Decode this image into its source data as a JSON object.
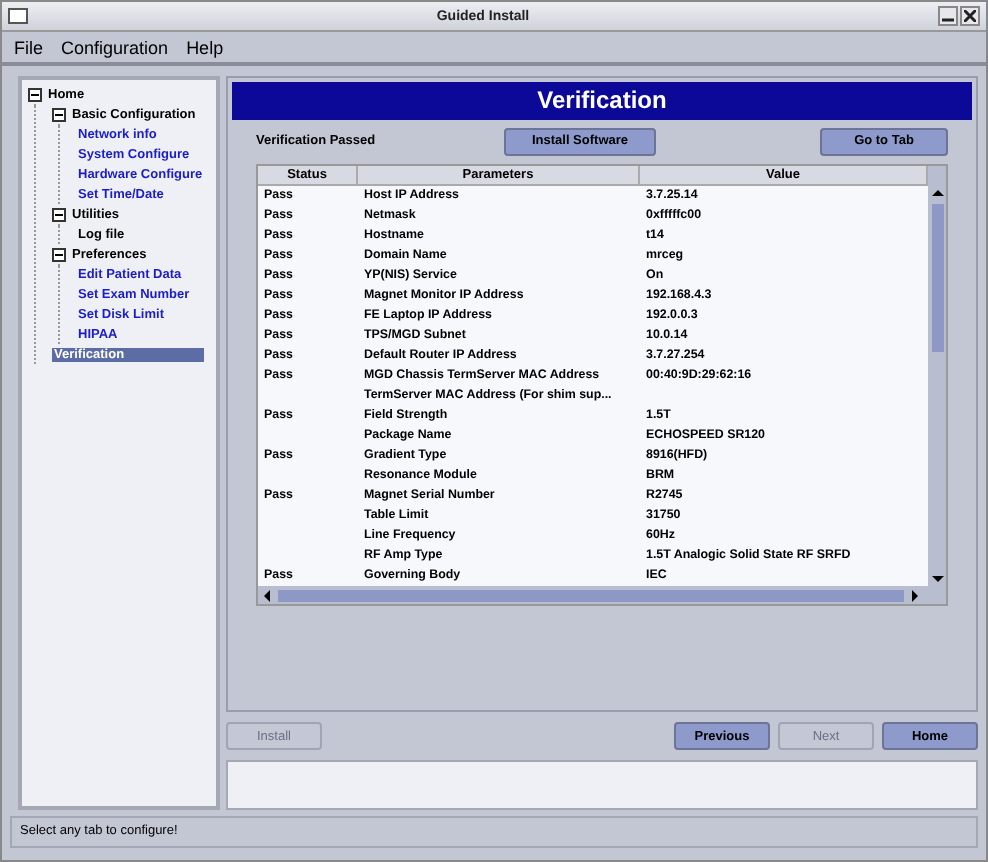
{
  "window": {
    "title": "Guided Install"
  },
  "menu": [
    "File",
    "Configuration",
    "Help"
  ],
  "tree": [
    {
      "label": "Home",
      "expanded": true,
      "selected": false,
      "color": "#000000",
      "children": [
        {
          "label": "Basic Configuration",
          "expanded": true,
          "selected": false,
          "color": "#000000",
          "children": [
            {
              "label": "Network info",
              "selected": false,
              "color": "#1c1cc8"
            },
            {
              "label": "System Configure",
              "selected": false,
              "color": "#1c1cc8"
            },
            {
              "label": "Hardware Configure",
              "selected": false,
              "color": "#1c1cc8"
            },
            {
              "label": "Set Time/Date",
              "selected": false,
              "color": "#1c1cc8"
            }
          ]
        },
        {
          "label": "Utilities",
          "expanded": true,
          "selected": false,
          "color": "#000000",
          "children": [
            {
              "label": "Log file",
              "selected": false,
              "color": "#000000"
            }
          ]
        },
        {
          "label": "Preferences",
          "expanded": true,
          "selected": false,
          "color": "#000000",
          "children": [
            {
              "label": "Edit Patient Data",
              "selected": false,
              "color": "#1c1cc8"
            },
            {
              "label": "Set Exam Number",
              "selected": false,
              "color": "#1c1cc8"
            },
            {
              "label": "Set Disk Limit",
              "selected": false,
              "color": "#1c1cc8"
            },
            {
              "label": "HIPAA",
              "selected": false,
              "color": "#1c1cc8"
            }
          ]
        },
        {
          "label": "Verification",
          "selected": true
        }
      ]
    }
  ],
  "panel": {
    "title": "Verification",
    "status_text": "Verification Passed",
    "buttons": [
      {
        "label": "Install Software"
      },
      {
        "label": "Go to Tab"
      }
    ]
  },
  "table": {
    "columns": [
      "Status",
      "Parameters",
      "Value"
    ],
    "rows": [
      {
        "status": "Pass",
        "parameter": "Host IP Address",
        "value": "3.7.25.14"
      },
      {
        "status": "Pass",
        "parameter": "Netmask",
        "value": "0xfffffc00"
      },
      {
        "status": "Pass",
        "parameter": "Hostname",
        "value": "t14"
      },
      {
        "status": "Pass",
        "parameter": "Domain Name",
        "value": "mrceg"
      },
      {
        "status": "Pass",
        "parameter": "YP(NIS) Service",
        "value": "On"
      },
      {
        "status": "Pass",
        "parameter": "Magnet Monitor IP Address",
        "value": "192.168.4.3"
      },
      {
        "status": "Pass",
        "parameter": "FE Laptop IP Address",
        "value": "192.0.0.3"
      },
      {
        "status": "Pass",
        "parameter": "TPS/MGD Subnet",
        "value": "10.0.14"
      },
      {
        "status": "Pass",
        "parameter": "Default Router IP Address",
        "value": "3.7.27.254"
      },
      {
        "status": "Pass",
        "parameter": "MGD Chassis TermServer MAC Address",
        "value": "00:40:9D:29:62:16"
      },
      {
        "parameter": "TermServer MAC Address (For shim sup..."
      },
      {
        "status": "Pass",
        "parameter": "Field Strength",
        "value": "1.5T"
      },
      {
        "parameter": "Package Name",
        "value": "ECHOSPEED SR120"
      },
      {
        "status": "Pass",
        "parameter": "Gradient Type",
        "value": "8916(HFD)"
      },
      {
        "parameter": "Resonance Module",
        "value": "BRM"
      },
      {
        "status": "Pass",
        "parameter": "Magnet Serial Number",
        "value": "R2745"
      },
      {
        "parameter": "Table Limit",
        "value": "31750"
      },
      {
        "parameter": "Line Frequency",
        "value": "60Hz"
      },
      {
        "parameter": "RF Amp Type",
        "value": "1.5T Analogic Solid State  RF SRFD"
      },
      {
        "status": "Pass",
        "parameter": "Governing Body",
        "value": "IEC"
      }
    ]
  },
  "nav_buttons": [
    {
      "label": "Install",
      "disabled": true
    },
    {
      "label": "Previous",
      "disabled": false
    },
    {
      "label": "Next",
      "disabled": true
    },
    {
      "label": "Home",
      "disabled": false
    }
  ],
  "status_bar": "Select any tab to configure!"
}
